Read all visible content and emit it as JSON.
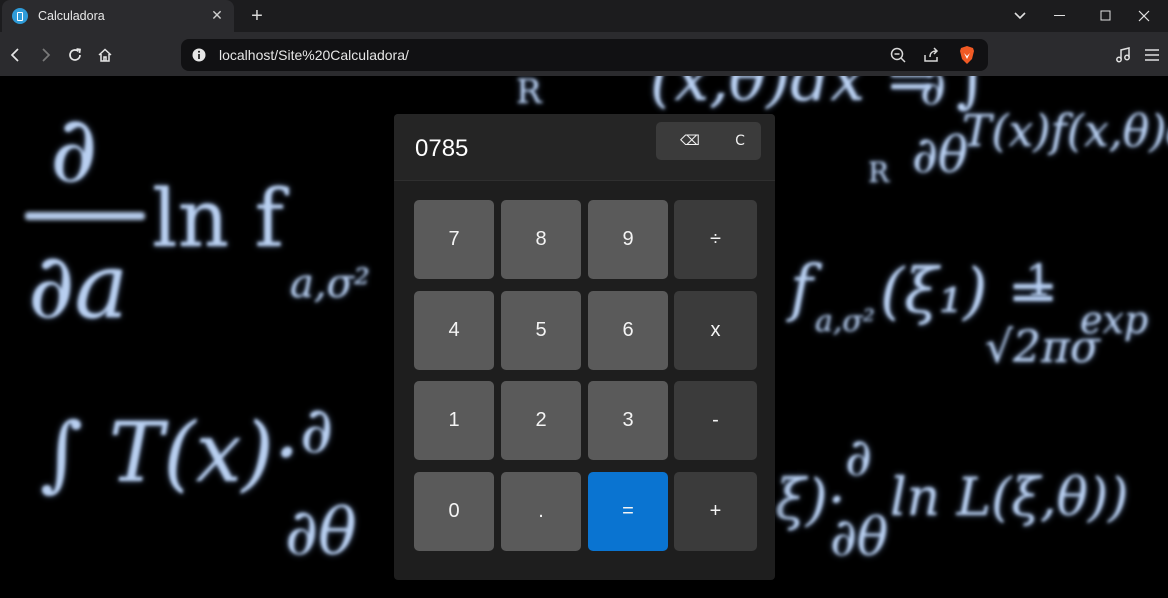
{
  "browser": {
    "tab_title": "Calculadora",
    "tab_close": "✕",
    "new_tab": "+",
    "url": "localhost/Site%20Calculadora/"
  },
  "calculator": {
    "display": "0785",
    "backspace_label": "⌫",
    "clear_label": "C",
    "keys": [
      {
        "label": "7",
        "kind": "digit"
      },
      {
        "label": "8",
        "kind": "digit"
      },
      {
        "label": "9",
        "kind": "digit"
      },
      {
        "label": "÷",
        "kind": "op"
      },
      {
        "label": "4",
        "kind": "digit"
      },
      {
        "label": "5",
        "kind": "digit"
      },
      {
        "label": "6",
        "kind": "digit"
      },
      {
        "label": "x",
        "kind": "op"
      },
      {
        "label": "1",
        "kind": "digit"
      },
      {
        "label": "2",
        "kind": "digit"
      },
      {
        "label": "3",
        "kind": "digit"
      },
      {
        "label": "-",
        "kind": "op"
      },
      {
        "label": "0",
        "kind": "digit"
      },
      {
        "label": ".",
        "kind": "digit"
      },
      {
        "label": "=",
        "kind": "equals"
      },
      {
        "label": "+",
        "kind": "op"
      }
    ]
  },
  "colors": {
    "equals_button": "#0a74d1",
    "digit_button": "#5a5a5a",
    "operator_button": "#3b3b3b",
    "panel": "#1e1e1e"
  },
  "background_formulas": [
    "∂",
    "∂a",
    "ln f",
    "a,σ²",
    "R",
    "(x,θ)dx = ∫",
    "∂",
    "∂θ",
    "T(x)f(x,θ)dx",
    "f",
    "a,σ²",
    "(ξ₁) =",
    "1",
    "√2πσ",
    "exp",
    "∫ T(x)·",
    "∂",
    "∂θ",
    "ξ)·",
    "∂",
    "∂θ",
    "ln L(ξ,θ))",
    "R"
  ]
}
